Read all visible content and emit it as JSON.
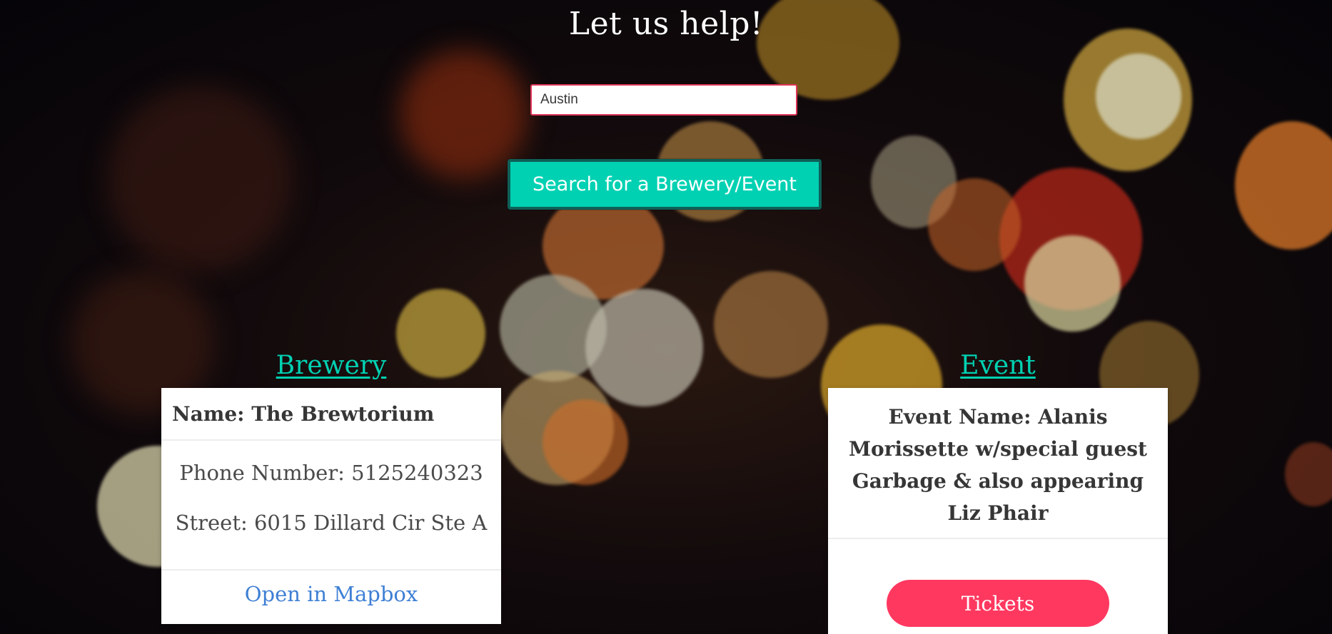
{
  "page": {
    "title": "Let us help!"
  },
  "search": {
    "value": "Austin",
    "button_label": "Search for a Brewery/Event"
  },
  "brewery": {
    "heading": "Brewery",
    "name": "Name: The Brewtorium",
    "phone": "Phone Number: 5125240323",
    "street": "Street: 6015 Dillard Cir Ste A",
    "map_link": "Open in Mapbox"
  },
  "event": {
    "heading": "Event",
    "name": "Event Name: Alanis Morissette w/special guest Garbage & also appearing Liz Phair",
    "tickets_label": "Tickets"
  },
  "colors": {
    "accent": "#00d1b2",
    "danger": "#ff3860",
    "link": "#3e7fd4"
  }
}
